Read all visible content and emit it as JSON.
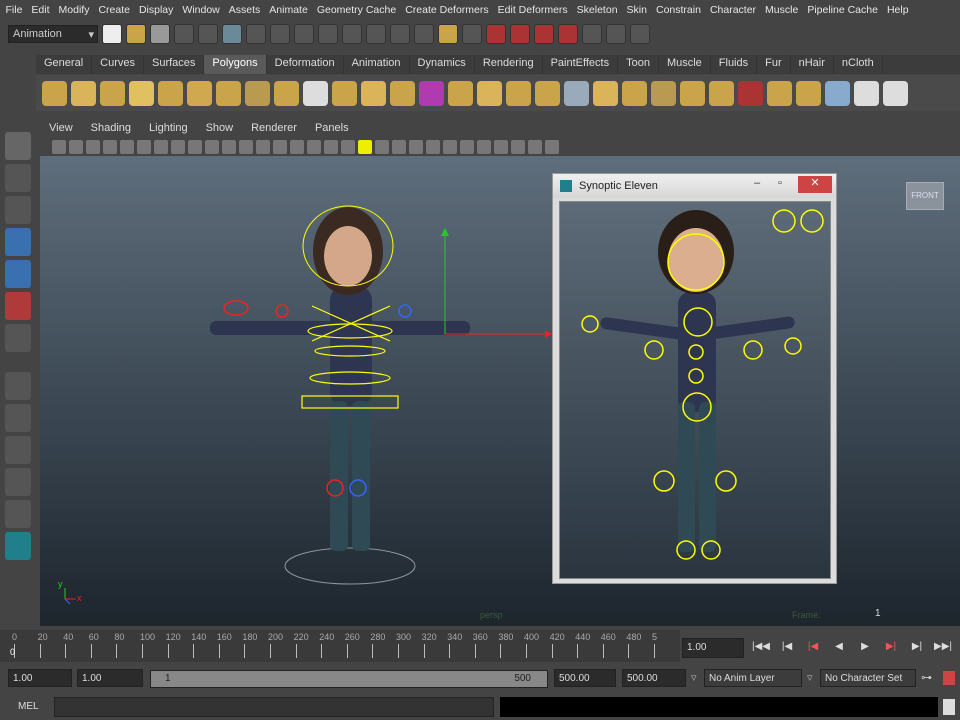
{
  "menu": [
    "File",
    "Edit",
    "Modify",
    "Create",
    "Display",
    "Window",
    "Assets",
    "Animate",
    "Geometry Cache",
    "Create Deformers",
    "Edit Deformers",
    "Skeleton",
    "Skin",
    "Constrain",
    "Character",
    "Muscle",
    "Pipeline Cache",
    "Help"
  ],
  "status": {
    "menu_set": "Animation"
  },
  "shelf_tabs": [
    "General",
    "Curves",
    "Surfaces",
    "Polygons",
    "Deformation",
    "Animation",
    "Dynamics",
    "Rendering",
    "PaintEffects",
    "Toon",
    "Muscle",
    "Fluids",
    "Fur",
    "nHair",
    "nCloth"
  ],
  "shelf_active": "Polygons",
  "panel_menu": [
    "View",
    "Shading",
    "Lighting",
    "Show",
    "Renderer",
    "Panels"
  ],
  "viewport": {
    "camera": "persp",
    "frame_label": "Frame:",
    "frame_value": "1",
    "cube_label": "FRONT",
    "axis_x": "x",
    "axis_y": "y"
  },
  "synoptic": {
    "title": "Synoptic Eleven"
  },
  "timeline": {
    "ticks": [
      "0",
      "20",
      "40",
      "60",
      "80",
      "100",
      "120",
      "140",
      "160",
      "180",
      "200",
      "220",
      "240",
      "260",
      "280",
      "300",
      "320",
      "340",
      "360",
      "380",
      "400",
      "420",
      "440",
      "460",
      "480",
      "5"
    ],
    "start_marker": "0",
    "current_time": "1.00"
  },
  "range": {
    "start": "1.00",
    "anim_start": "1.00",
    "slider_start": "1",
    "slider_end": "500",
    "end": "500.00",
    "anim_end": "500.00",
    "anim_layer": "No Anim Layer",
    "character_set": "No Character Set"
  },
  "command": {
    "label": "MEL"
  }
}
